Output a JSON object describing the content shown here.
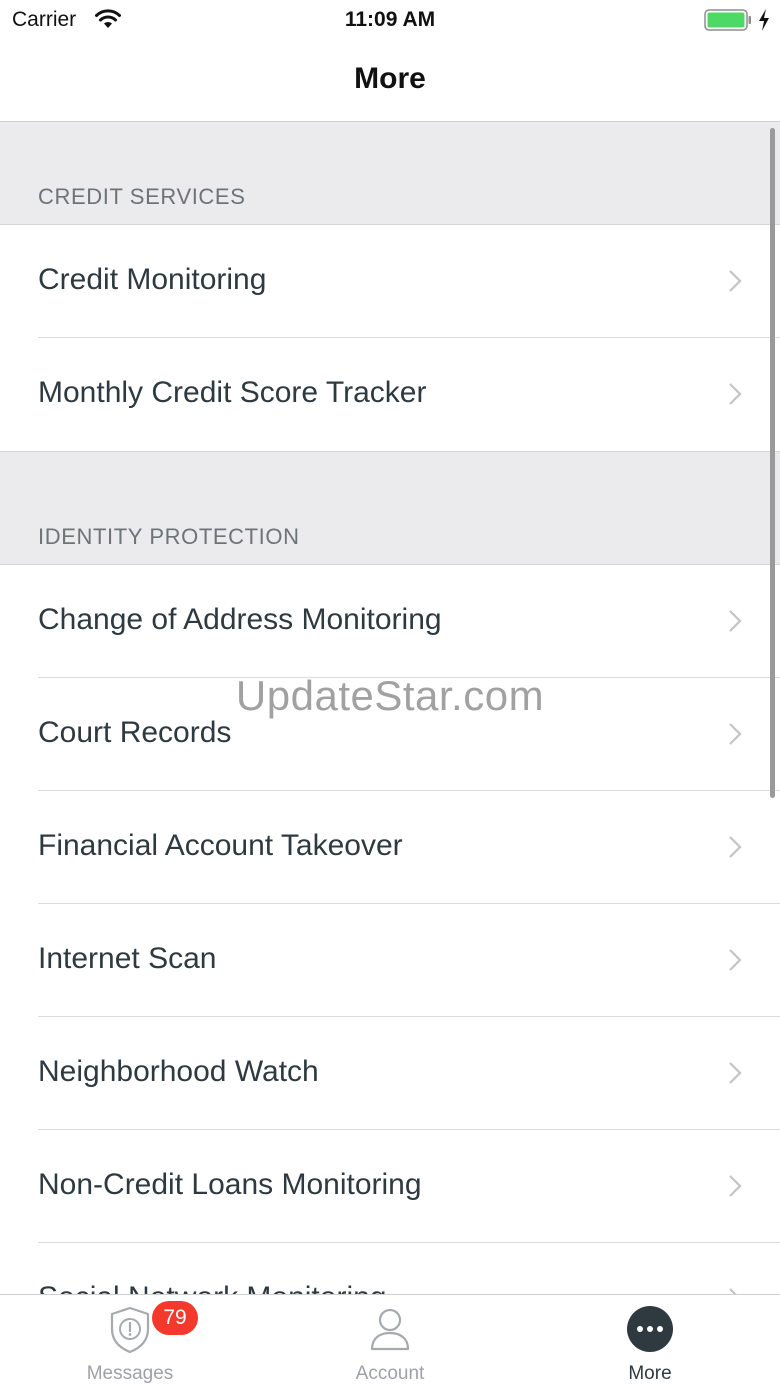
{
  "status_bar": {
    "carrier": "Carrier",
    "time": "11:09 AM",
    "battery_color": "#4cd964"
  },
  "nav": {
    "title": "More"
  },
  "sections": [
    {
      "header": "CREDIT SERVICES",
      "items": [
        {
          "label": "Credit Monitoring"
        },
        {
          "label": "Monthly Credit Score Tracker"
        }
      ]
    },
    {
      "header": "IDENTITY PROTECTION",
      "items": [
        {
          "label": "Change of Address Monitoring"
        },
        {
          "label": "Court Records"
        },
        {
          "label": "Financial Account Takeover"
        },
        {
          "label": "Internet Scan"
        },
        {
          "label": "Neighborhood Watch"
        },
        {
          "label": "Non-Credit Loans Monitoring"
        },
        {
          "label": "Social Network Monitoring"
        }
      ]
    }
  ],
  "watermark": "UpdateStar.com",
  "tabs": [
    {
      "label": "Messages",
      "icon": "shield-alert-icon",
      "badge": "79",
      "active": false
    },
    {
      "label": "Account",
      "icon": "person-icon",
      "active": false
    },
    {
      "label": "More",
      "icon": "more-dots-icon",
      "active": true
    }
  ],
  "colors": {
    "badge": "#f2392c",
    "section_background": "#ebebed",
    "active_icon": "#2f3a40"
  }
}
